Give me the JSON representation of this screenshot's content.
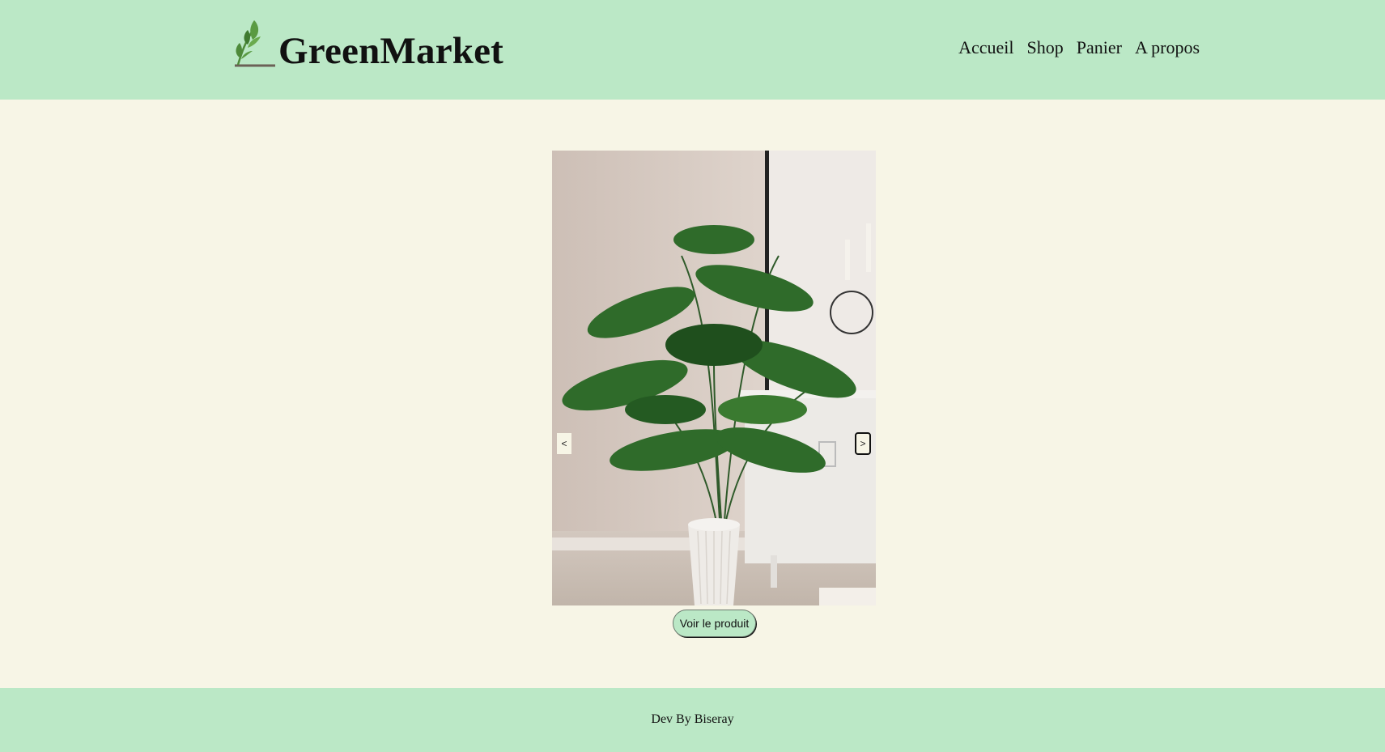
{
  "header": {
    "brand": "GreenMarket",
    "logo_icon": "leaf-sprout-icon",
    "nav": [
      "Accueil",
      "Shop",
      "Panier",
      "A propos"
    ]
  },
  "carousel": {
    "image_description": "potted palm plant",
    "prev_label": "<",
    "next_label": ">"
  },
  "cta": {
    "label": "Voir le produit"
  },
  "footer": {
    "credit": "Dev By Biseray"
  },
  "colors": {
    "header_bg": "#bbe8c6",
    "page_bg": "#f7f5e6",
    "footer_bg": "#bbe8c6",
    "accent_green": "#4e8a3a"
  }
}
